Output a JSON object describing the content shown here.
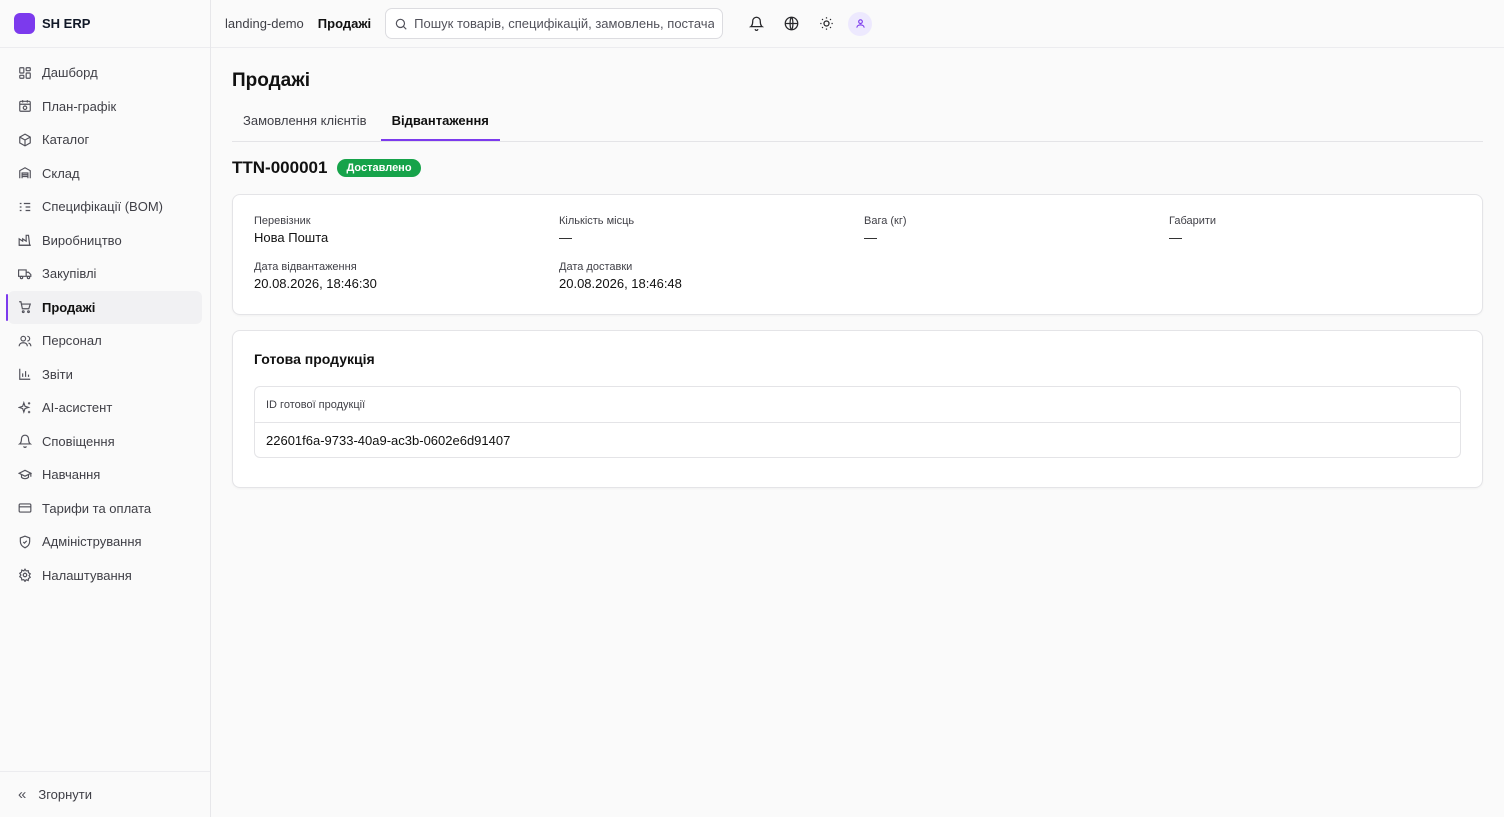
{
  "brand": {
    "name": "SH ERP",
    "color": "#7c3aed"
  },
  "sidebar": {
    "items": [
      {
        "label": "Дашборд",
        "icon": "dashboard-icon"
      },
      {
        "label": "План-графік",
        "icon": "calendar-clock-icon"
      },
      {
        "label": "Каталог",
        "icon": "box-icon"
      },
      {
        "label": "Склад",
        "icon": "warehouse-icon"
      },
      {
        "label": "Специфікації (BOM)",
        "icon": "list-tree-icon"
      },
      {
        "label": "Виробництво",
        "icon": "factory-icon"
      },
      {
        "label": "Закупівлі",
        "icon": "truck-icon"
      },
      {
        "label": "Продажі",
        "icon": "cart-icon",
        "active": true
      },
      {
        "label": "Персонал",
        "icon": "users-icon"
      },
      {
        "label": "Звіти",
        "icon": "bar-chart-icon"
      },
      {
        "label": "AI-асистент",
        "icon": "sparkles-icon"
      },
      {
        "label": "Сповіщення",
        "icon": "bell-icon"
      },
      {
        "label": "Навчання",
        "icon": "graduation-cap-icon"
      },
      {
        "label": "Тарифи та оплата",
        "icon": "credit-card-icon"
      },
      {
        "label": "Адміністрування",
        "icon": "shield-icon"
      },
      {
        "label": "Налаштування",
        "icon": "gear-icon"
      }
    ],
    "collapse_label": "Згорнути"
  },
  "topbar": {
    "breadcrumb": [
      "landing-demo",
      "Продажі"
    ],
    "search_placeholder": "Пошук товарів, специфікацій, замовлень, постачальників"
  },
  "page": {
    "title": "Продажі",
    "tabs": [
      {
        "label": "Замовлення клієнтів",
        "active": false
      },
      {
        "label": "Відвантаження",
        "active": true
      }
    ]
  },
  "shipment": {
    "number": "TTN-000001",
    "status": "Доставлено",
    "status_color": "#16a34a",
    "fields": {
      "carrier": {
        "label": "Перевізник",
        "value": "Нова Пошта"
      },
      "places": {
        "label": "Кількість місць",
        "value": "—"
      },
      "weight": {
        "label": "Вага (кг)",
        "value": "—"
      },
      "dimensions": {
        "label": "Габарити",
        "value": "—"
      },
      "shipped_at": {
        "label": "Дата відвантаження",
        "value": "20.08.2026, 18:46:30"
      },
      "delivered_at": {
        "label": "Дата доставки",
        "value": "20.08.2026, 18:46:48"
      }
    }
  },
  "products": {
    "title": "Готова продукція",
    "columns": [
      "ID готової продукції"
    ],
    "rows": [
      [
        "22601f6a-9733-40a9-ac3b-0602e6d91407"
      ]
    ]
  }
}
